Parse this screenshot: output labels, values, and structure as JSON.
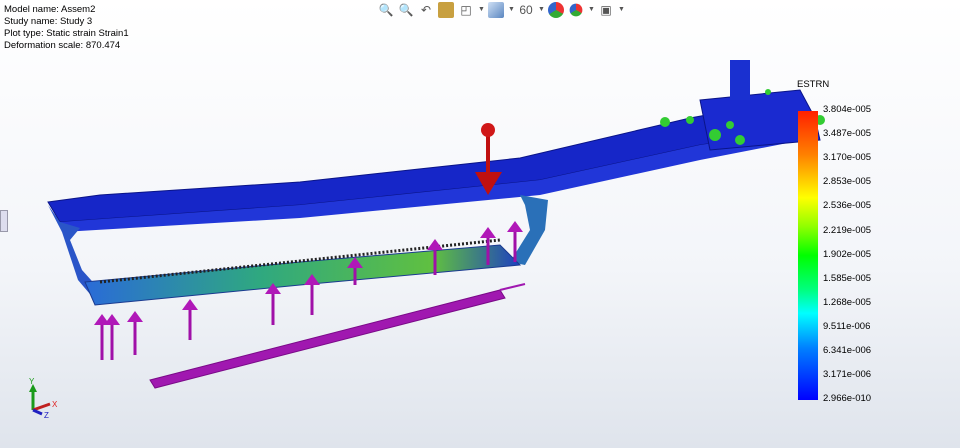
{
  "info": {
    "model": "Model name: Assem2",
    "study": "Study name: Study 3",
    "plot": "Plot type: Static strain Strain1",
    "scale": "Deformation scale: 870.474"
  },
  "toolbar": [
    "zoom-to-fit-icon",
    "zoom-to-area-icon",
    "previous-view-icon",
    "section-view-icon",
    "view-orientation-icon",
    "display-style-icon",
    "hide-show-icon",
    "edit-appearance-icon",
    "apply-scene-icon",
    "view-settings-icon"
  ],
  "legend": {
    "title": "ESTRN",
    "labels": [
      "3.804e-005",
      "3.487e-005",
      "3.170e-005",
      "2.853e-005",
      "2.536e-005",
      "2.219e-005",
      "1.902e-005",
      "1.585e-005",
      "1.268e-005",
      "9.511e-006",
      "6.341e-006",
      "3.171e-006",
      "2.966e-010"
    ]
  },
  "triad": {
    "x": "X",
    "y": "Y",
    "z": "Z"
  }
}
